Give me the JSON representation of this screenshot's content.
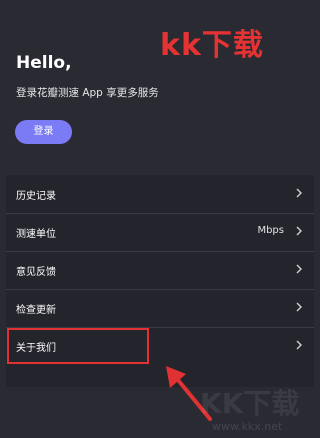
{
  "watermark": {
    "top_text": "kk下载",
    "bottom_text": "KK下载",
    "url": "www.kkx.net"
  },
  "header": {
    "greeting": "Hello,",
    "subtitle": "登录花瓣测速 App 享更多服务",
    "login_label": "登录"
  },
  "menu": {
    "items": [
      {
        "label": "历史记录",
        "value": ""
      },
      {
        "label": "测速单位",
        "value": "Mbps"
      },
      {
        "label": "意见反馈",
        "value": ""
      },
      {
        "label": "检查更新",
        "value": ""
      },
      {
        "label": "关于我们",
        "value": ""
      }
    ]
  },
  "colors": {
    "background": "#2a2a33",
    "card": "#24242c",
    "accent": "#7b7cf5",
    "annotation_red": "#e03232"
  },
  "icons": {
    "chevron": "chevron-right-icon",
    "arrow": "arrow-up-left-icon"
  }
}
